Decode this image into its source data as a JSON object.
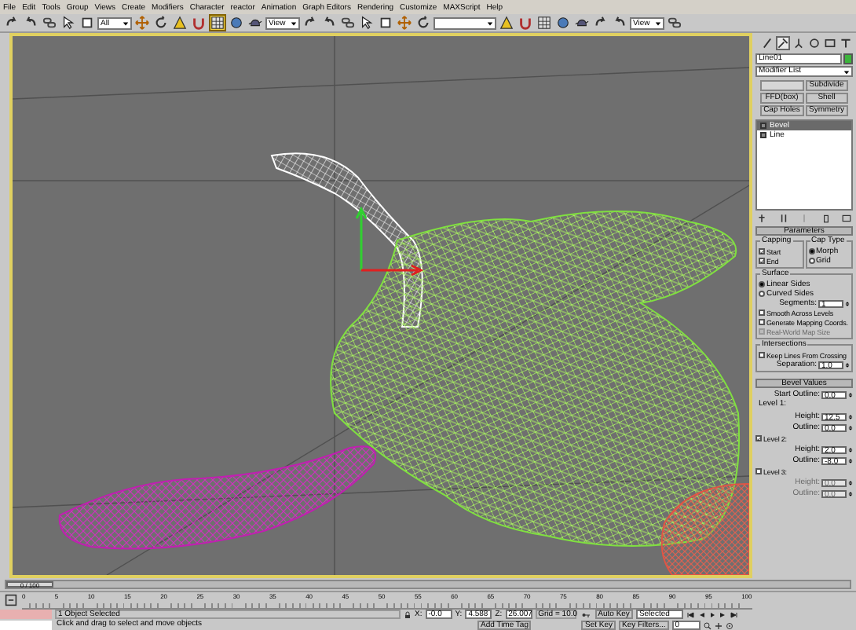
{
  "menu": [
    "File",
    "Edit",
    "Tools",
    "Group",
    "Views",
    "Create",
    "Modifiers",
    "Character",
    "reactor",
    "Animation",
    "Graph Editors",
    "Rendering",
    "Customize",
    "MAXScript",
    "Help"
  ],
  "toolbar": [
    {
      "kind": "tool",
      "selected": false
    },
    {
      "kind": "tool",
      "selected": false
    },
    {
      "kind": "tool",
      "selected": false
    },
    {
      "kind": "tool",
      "selected": false
    },
    {
      "kind": "tool",
      "selected": false
    },
    {
      "kind": "dropdown",
      "value": "All"
    },
    {
      "kind": "tool",
      "selected": false
    },
    {
      "kind": "tool",
      "selected": false
    },
    {
      "kind": "tool",
      "selected": false
    },
    {
      "kind": "tool",
      "selected": false
    },
    {
      "kind": "tool",
      "selected": true
    },
    {
      "kind": "tool",
      "selected": false
    },
    {
      "kind": "tool",
      "selected": false
    },
    {
      "kind": "dropdown",
      "value": "View"
    },
    {
      "kind": "tool",
      "selected": false
    },
    {
      "kind": "tool",
      "selected": false
    },
    {
      "kind": "tool",
      "selected": false
    },
    {
      "kind": "tool",
      "selected": false
    },
    {
      "kind": "tool",
      "selected": false
    },
    {
      "kind": "tool",
      "selected": false
    },
    {
      "kind": "tool",
      "selected": false
    },
    {
      "kind": "dropdown"
    },
    {
      "kind": "tool",
      "selected": false
    },
    {
      "kind": "tool",
      "selected": false
    },
    {
      "kind": "tool",
      "selected": false
    },
    {
      "kind": "tool",
      "selected": false
    },
    {
      "kind": "tool",
      "selected": false
    },
    {
      "kind": "tool",
      "selected": false
    },
    {
      "kind": "tool",
      "selected": false
    },
    {
      "kind": "dropdown",
      "value": "View"
    },
    {
      "kind": "tool",
      "selected": false
    }
  ],
  "command_panel": {
    "tabs": [
      {
        "selected": false
      },
      {
        "selected": true
      },
      {
        "selected": false
      },
      {
        "selected": false
      },
      {
        "selected": false
      },
      {
        "selected": false
      }
    ],
    "object_name": "Line01",
    "modifier_list": "Modifier List",
    "modifier_buttons": [
      {
        "disabled": true
      },
      {
        "label": "Subdivide",
        "disabled": false
      },
      {
        "label": "FFD(box)",
        "disabled": false
      },
      {
        "label": "Shell",
        "disabled": false
      },
      {
        "label": "Cap Holes",
        "disabled": false
      },
      {
        "label": "Symmetry",
        "disabled": false
      }
    ],
    "stack": [
      {
        "label": "Bevel",
        "selected": true
      },
      {
        "label": "Line",
        "selected": false
      }
    ]
  },
  "parameters": {
    "title": "Parameters",
    "capping": {
      "title": "Capping",
      "options": [
        {
          "label": "Start",
          "checked": true
        },
        {
          "label": "End",
          "checked": true
        }
      ]
    },
    "cap_type": {
      "title": "Cap Type",
      "options": [
        {
          "label": "Morph",
          "selected": true
        },
        {
          "label": "Grid",
          "selected": false
        }
      ]
    },
    "surface": {
      "title": "Surface",
      "options": [
        {
          "label": "Linear Sides",
          "selected": true
        },
        {
          "label": "Curved Sides",
          "selected": false
        }
      ],
      "segments": {
        "label": "Segments:",
        "value": "1"
      },
      "checks": [
        {
          "label": "Smooth Across Levels",
          "checked": false,
          "disabled": false
        },
        {
          "label": "Generate Mapping Coords.",
          "checked": false,
          "disabled": false
        },
        {
          "label": "Real-World Map Size",
          "checked": false,
          "disabled": true
        }
      ]
    },
    "intersections": {
      "title": "Intersections",
      "keep": {
        "label": "Keep Lines From Crossing",
        "checked": false
      },
      "separation": {
        "label": "Separation:",
        "value": "1.0"
      }
    }
  },
  "bevel_values": {
    "title": "Bevel Values",
    "start_outline": {
      "label": "Start Outline:",
      "value": "0.0"
    },
    "levels": [
      {
        "kind": "fixed",
        "label": "Level 1:",
        "fields": [
          {
            "label": "Height:",
            "value": "12.5"
          },
          {
            "label": "Outline:",
            "value": "0.0"
          }
        ]
      },
      {
        "kind": "optional",
        "label": "Level 2:",
        "checked": true,
        "fields": [
          {
            "label": "Height:",
            "value": "2.0"
          },
          {
            "label": "Outline:",
            "value": "-8.0"
          }
        ]
      },
      {
        "kind": "optional",
        "label": "Level 3:",
        "checked": false,
        "fields": [
          {
            "label": "Height:",
            "value": "0.0"
          },
          {
            "label": "Outline:",
            "value": "0.0"
          }
        ]
      }
    ]
  },
  "time_slider": {
    "label": "0 / 100",
    "level": 0
  },
  "track_ticks": [
    "0",
    "5",
    "10",
    "15",
    "20",
    "25",
    "30",
    "35",
    "40",
    "45",
    "50",
    "55",
    "60",
    "65",
    "70",
    "75",
    "80",
    "85",
    "90",
    "95",
    "100"
  ],
  "status": {
    "selection": "1 Object Selected",
    "prompt": "Click and drag to select and move objects",
    "coords": [
      {
        "label": "X:",
        "value": "-0.0"
      },
      {
        "label": "Y:",
        "value": "4.588"
      },
      {
        "label": "Z:",
        "value": "26.007"
      }
    ],
    "grid": "Grid = 10.0",
    "add_time_tag": "Add Time Tag",
    "auto_key": "Auto Key",
    "key_mode": "Selected",
    "set_key": "Set Key",
    "key_filters": "Key Filters...",
    "frame": "0"
  }
}
